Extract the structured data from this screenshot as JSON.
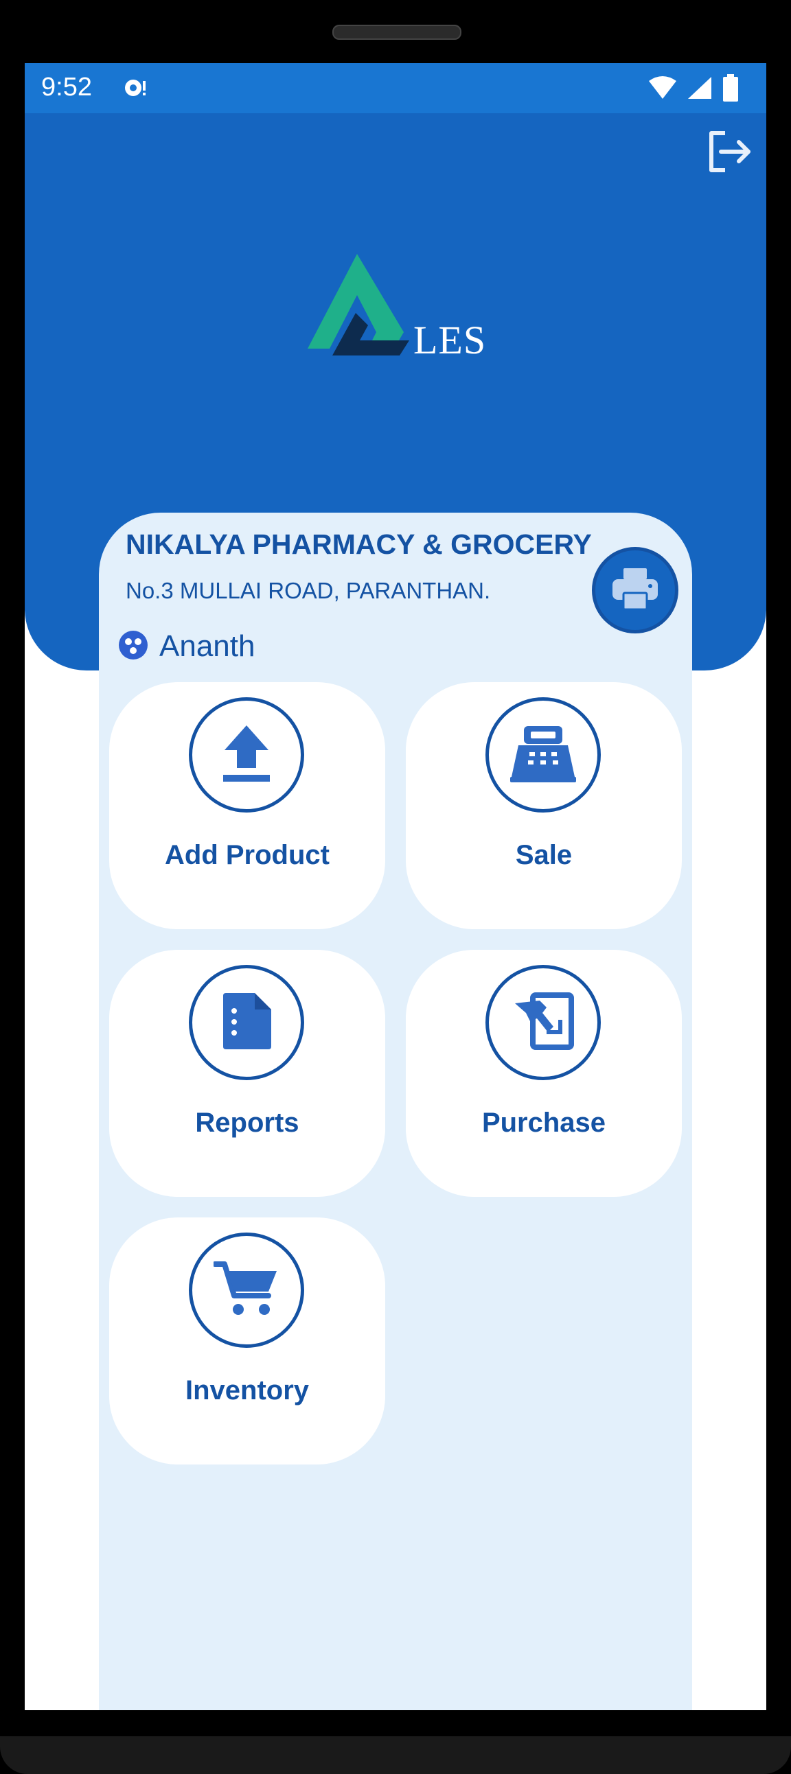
{
  "status_bar": {
    "time": "9:52",
    "icons": [
      "sync-icon",
      "wifi-icon",
      "signal-icon",
      "battery-icon"
    ]
  },
  "header": {
    "logo_text": "LES",
    "logout_icon": "logout-icon"
  },
  "store": {
    "name": "NIKALYA PHARMACY & GROCERY",
    "address": "No.3 MULLAI ROAD, PARANTHAN.",
    "print_icon": "printer-icon"
  },
  "user": {
    "name": "Ananth",
    "icon": "user-group-icon"
  },
  "menu": {
    "items": [
      {
        "label": "Add Product",
        "icon": "upload-icon"
      },
      {
        "label": "Sale",
        "icon": "cash-register-icon"
      },
      {
        "label": "Reports",
        "icon": "report-file-icon"
      },
      {
        "label": "Purchase",
        "icon": "purchase-icon"
      },
      {
        "label": "Inventory",
        "icon": "cart-icon"
      }
    ]
  },
  "colors": {
    "primary": "#1565c0",
    "status_bar": "#1976d2",
    "text_primary": "#1452a3",
    "panel_bg": "#e3f0fb",
    "logo_green": "#1fb08a",
    "logo_navy": "#0d2b4e"
  }
}
